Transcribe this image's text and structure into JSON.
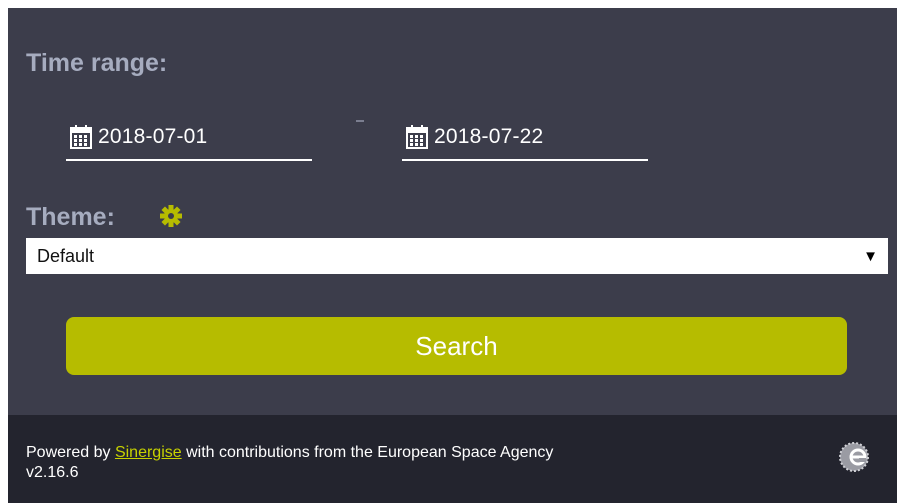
{
  "time_range": {
    "label": "Time range:",
    "start_date": "2018-07-01",
    "end_date": "2018-07-22"
  },
  "theme": {
    "label": "Theme:",
    "selected": "Default",
    "arrow": "▼"
  },
  "search_button": {
    "label": "Search"
  },
  "footer": {
    "powered_by": "Powered by ",
    "link_text": "Sinergise",
    "rest": " with contributions from the European Space Agency",
    "version": "v2.16.6"
  },
  "icons": {
    "calendar": "calendar-icon",
    "settings": "gear-icon",
    "logo": "esa-logo-icon"
  },
  "colors": {
    "panel_bg": "#3c3d4b",
    "label": "#a6acbf",
    "accent": "#b6bc00",
    "link": "#c7d200",
    "footer_bg": "#23242e"
  }
}
